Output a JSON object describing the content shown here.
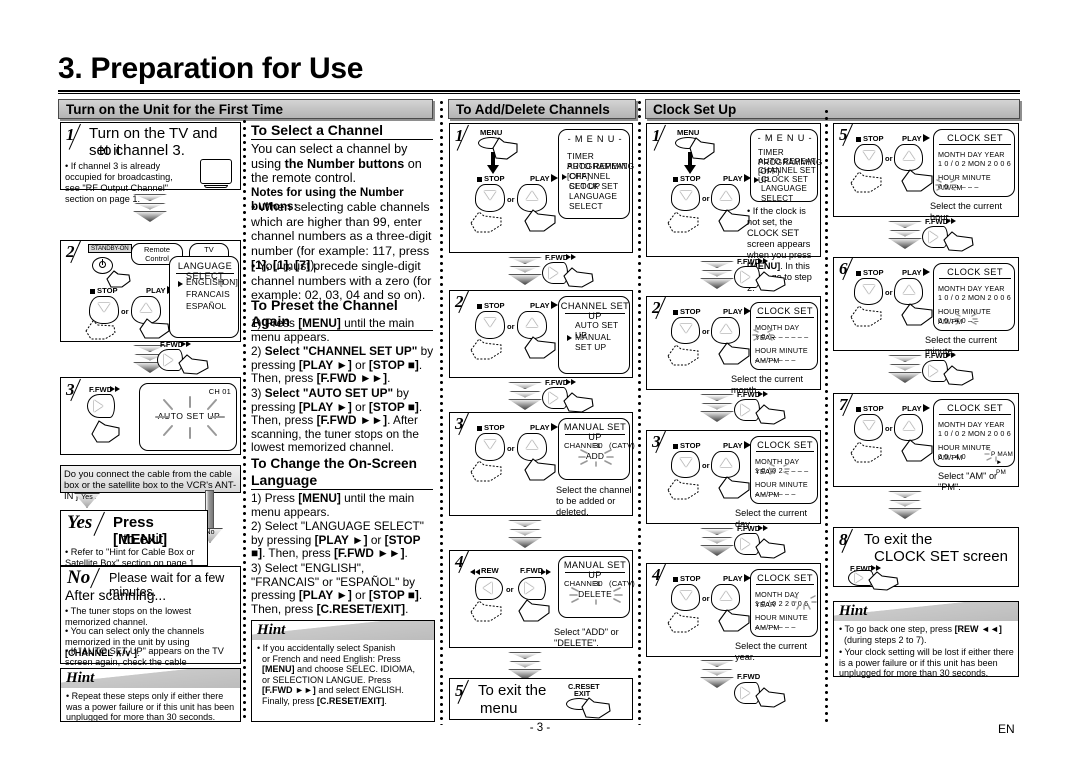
{
  "document": {
    "title": "3. Preparation for Use",
    "page_number": "- 3 -",
    "language_code": "EN"
  },
  "sections": {
    "first_time": {
      "header": "Turn on the Unit for the First Time"
    },
    "add_delete": {
      "header": "To Add/Delete Channels"
    },
    "clock": {
      "header": "Clock Set Up"
    }
  },
  "col1": {
    "step1": {
      "num": "1",
      "line1": "Turn on the TV and set it",
      "line2": "to channel 3.",
      "bullet": "• If channel 3 is already occupied for broadcasting, see \"RF Output Channel\" section on page 1."
    },
    "step2": {
      "num": "2",
      "standby_label": "STANDBY-ON",
      "callout_remote": "Remote Control",
      "callout_tv": "TV Screen",
      "stop_label": "STOP",
      "play_label": "PLAY",
      "or_label": "or",
      "osd_title": "LANGUAGE SELECT",
      "osd_item1": "ENGLISH",
      "osd_item1_state": "[ON]",
      "osd_item2": "FRANCAIS",
      "osd_item3": "ESPAÑOL",
      "ffwd_label": "F.FWD"
    },
    "step3": {
      "num": "3",
      "ffwd_label": "F.FWD",
      "ch_label": "CH 01",
      "osd_text": "AUTO SET UP"
    },
    "question": "Do you connect the cable from the cable box or the satellite box to the VCR's ANT-IN jack?",
    "yes_tag": "Yes",
    "no_tag": "No",
    "yes_box": {
      "word": "Yes",
      "line1": "Press [MENU]",
      "line2": "to exit.",
      "bullet": "• Refer to \"Hint for Cable Box or Satellite Box\" section on page 1."
    },
    "no_box": {
      "word": "No",
      "line1": "Please wait for a few minutes.",
      "heading": "After scanning...",
      "b1": "• The tuner stops on the lowest memorized channel.",
      "b2_a": "• You can select only the channels memorized in the unit by using ",
      "b2_b": "[CHANNEL  ∧/∨ ]",
      "b2_c": ".",
      "b3_a": "• If \"AUTO SET UP\" appears on the TV screen again, check the cable connections. Then, press ",
      "b3_b": "[F.FWD ►►]",
      "b3_c": " once again."
    },
    "hint": {
      "title": "Hint",
      "body": "• Repeat these steps only if either there was a power failure or if this unit has been unplugged for more than 30 seconds."
    }
  },
  "col2": {
    "h1": "To Select a Channel",
    "p1_a": "You can select a channel by using ",
    "p1_b": "the Number buttons",
    "p1_c": " on the remote control.",
    "p2": "Notes for using the Number buttons:",
    "b1_a": "• When selecting cable channels which are higher than 99, enter channel numbers as a three-digit number (for example: 117, press ",
    "b1_b": "[1], [1], [7]",
    "b1_c": ").",
    "b2": "• You must precede single-digit channel numbers with a zero (for example: 02, 03, 04 and so on).",
    "h2": "To Preset the Channel Again",
    "p_1_a": "1) Press ",
    "p_1_b": "[MENU]",
    "p_1_c": " until the main menu appears.",
    "p_2_a": "2) ",
    "p_2_b": "Select \"CHANNEL SET UP\"",
    "p_2_c": " by pressing ",
    "p_2_d": "[PLAY ►]",
    "p_2_e": " or ",
    "p_2_f": "[STOP ■]",
    "p_2_g": ". Then, press ",
    "p_2_h": "[F.FWD ►►]",
    "p_2_i": ".",
    "p_3_a": "3) ",
    "p_3_b": "Select \"AUTO SET UP\"",
    "p_3_c": " by pressing ",
    "p_3_d": "[PLAY ►]",
    "p_3_e": " or ",
    "p_3_f": "[STOP ■]",
    "p_3_g": ". Then, press ",
    "p_3_h": "[F.FWD ►►]",
    "p_3_i": ". After scanning, the tuner stops on the lowest memorized channel.",
    "h3_l1": "To Change the On-Screen",
    "h3_l2": "Language",
    "q_1_a": "1) Press ",
    "q_1_b": "[MENU]",
    "q_1_c": " until the main menu appears.",
    "q_2_a": "2) Select \"LANGUAGE SELECT\" by pressing ",
    "q_2_b": "[PLAY ►]",
    "q_2_c": " or ",
    "q_2_d": "[STOP ■]",
    "q_2_e": ". Then, press ",
    "q_2_f": "[F.FWD ►►]",
    "q_2_g": ".",
    "q_3_a": "3) Select \"ENGLISH\", \"FRANCAIS\" or \"ESPAÑOL\" by pressing ",
    "q_3_b": "[PLAY ►]",
    "q_3_c": " or ",
    "q_3_d": "[STOP ■]",
    "q_3_e": ". Then, press ",
    "q_3_f": "[C.RESET/EXIT]",
    "q_3_g": ".",
    "hint": {
      "title": "Hint",
      "l1": "• If you accidentally select Spanish",
      "l2": "or French and need English: Press",
      "l3_a": "[MENU]",
      "l3_b": " and choose SELEC. IDIOMA,",
      "l4": "or SELECTION LANGUE. Press",
      "l5_a": "[F.FWD ►►]",
      "l5_b": " and select ENGLISH.",
      "l6_a": "Finally, press ",
      "l6_b": "[C.RESET/EXIT]",
      "l6_c": "."
    }
  },
  "col3": {
    "step1": {
      "num": "1",
      "menu_btn": "MENU",
      "stop_label": "STOP",
      "play_label": "PLAY",
      "or_label": "or",
      "osd_title": "- M E N U -",
      "osd_items": [
        "TIMER PROGRAMMING",
        "AUTO REPEAT  [OFF]",
        "CHANNEL SET UP",
        "CLOCK SET",
        "LANGUAGE SELECT"
      ],
      "cursor_index": 2,
      "ffwd_label": "F.FWD"
    },
    "step2": {
      "num": "2",
      "stop_label": "STOP",
      "play_label": "PLAY",
      "or_label": "or",
      "osd_title": "CHANNEL SET UP",
      "osd_items": [
        "AUTO SET UP",
        "MANUAL SET UP"
      ],
      "cursor_index": 1,
      "ffwd_label": "F.FWD"
    },
    "step3": {
      "num": "3",
      "stop_label": "STOP",
      "play_label": "PLAY",
      "or_label": "or",
      "osd_title": "MANUAL SET UP",
      "channel_label": "CHANNEL",
      "channel_num": "30",
      "catv": "(CATV)",
      "blink": "ADD",
      "caption": "Select the channel to be added or deleted.",
      "ffwd_label": "F.FWD"
    },
    "step4": {
      "num": "4",
      "rew_label": "REW",
      "ffwd_label": "F.FWD",
      "or_label": "or",
      "osd_title": "MANUAL SET UP",
      "channel_label": "CHANNEL",
      "channel_num": "30",
      "catv": "(CATV)",
      "blink": "DELETE",
      "caption": "Select \"ADD\" or \"DELETE\"."
    },
    "step5": {
      "num": "5",
      "line1": "To exit the",
      "line2": "menu",
      "btn_l1": "C.RESET",
      "btn_l2": "EXIT"
    }
  },
  "col4": {
    "step1": {
      "num": "1",
      "menu_btn": "MENU",
      "stop_label": "STOP",
      "play_label": "PLAY",
      "or_label": "or",
      "osd_title": "- M E N U -",
      "osd_items": [
        "TIMER PROGRAMMING",
        "AUTO REPEAT  [OFF]",
        "CHANNEL SET UP",
        "CLOCK SET",
        "LANGUAGE SELECT"
      ],
      "cursor_index": 3,
      "note_a": "• If the clock is not set, the CLOCK SET screen appears when you press ",
      "note_b": "[MENU]",
      "note_c": ". In this case, go to step 2.",
      "ffwd_label": "F.FWD"
    },
    "step2": {
      "num": "2",
      "stop_label": "STOP",
      "play_label": "PLAY",
      "or_label": "or",
      "osd_title": "CLOCK SET",
      "row1_labels": "MONTH  DAY              YEAR",
      "row1_values": "1 0  /  – –            – – – –",
      "row2_labels": "HOUR  MINUTE        AM/PM",
      "row2_values": "– –  :  – –              – –",
      "caption": "Select the current month.",
      "ffwd_label": "F.FWD"
    },
    "step3": {
      "num": "3",
      "stop_label": "STOP",
      "play_label": "PLAY",
      "or_label": "or",
      "osd_title": "CLOCK SET",
      "row1_labels": "MONTH  DAY              YEAR",
      "row1_values": "1 0  /  0 2            – – – –",
      "row2_labels": "HOUR  MINUTE        AM/PM",
      "row2_values": "– –  :  – –              – –",
      "caption": "Select the current day.",
      "ffwd_label": "F.FWD"
    },
    "step4": {
      "num": "4",
      "stop_label": "STOP",
      "play_label": "PLAY",
      "or_label": "or",
      "osd_title": "CLOCK SET",
      "row1_labels": "MONTH  DAY              YEAR",
      "row1_values": "1 0  /  0 2           2 0 0 6",
      "row2_labels": "HOUR  MINUTE        AM/PM",
      "row2_values": "– –  :  – –              – –",
      "caption": "Select the current year.",
      "ffwd_label": "F.FWD"
    }
  },
  "col5": {
    "step5": {
      "num": "5",
      "stop_label": "STOP",
      "play_label": "PLAY",
      "or_label": "or",
      "osd_title": "CLOCK SET",
      "row1_labels": "MONTH  DAY                 YEAR",
      "row1_values": "1 0  /  0 2  MON  2 0 0 6",
      "row2_labels": "HOUR  MINUTE        AM/PM",
      "row2_values": "0 5  :  – –                – –",
      "caption": "Select the current hour.",
      "ffwd_label": "F.FWD"
    },
    "step6": {
      "num": "6",
      "stop_label": "STOP",
      "play_label": "PLAY",
      "or_label": "or",
      "osd_title": "CLOCK SET",
      "row1_labels": "MONTH  DAY                 YEAR",
      "row1_values": "1 0  /  0 2  MON  2 0 0 6",
      "row2_labels": "HOUR  MINUTE        AM/PM",
      "row2_values": "0 5  :  4 0                – –",
      "caption": "Select the current minute.",
      "ffwd_label": "F.FWD"
    },
    "step7": {
      "num": "7",
      "stop_label": "STOP",
      "play_label": "PLAY",
      "or_label": "or",
      "osd_title": "CLOCK SET",
      "row1_labels": "MONTH  DAY                 YEAR",
      "row1_values": "1 0  /  0 2  MON  2 0 0 6",
      "row2_labels": "HOUR  MINUTE        AM/PM",
      "row2_values": "0 5  :  4 0",
      "ampm_blink": "P M",
      "ampm_opt1": "AM",
      "ampm_opt2": "► PM",
      "caption": "Select \"AM\" or \"PM\".",
      "ffwd_label": "F.FWD"
    },
    "step8": {
      "num": "8",
      "line1": "To exit the",
      "line2": "CLOCK SET screen",
      "ffwd_label": "F.FWD"
    },
    "hint": {
      "title": "Hint",
      "l1_a": "• To go back one step, press ",
      "l1_b": "[REW ◄◄]",
      "l2": "(during steps 2 to 7).",
      "l3": "• Your clock setting will be lost if either there is a power failure or if this unit has been unplugged for more than 30 seconds."
    }
  }
}
